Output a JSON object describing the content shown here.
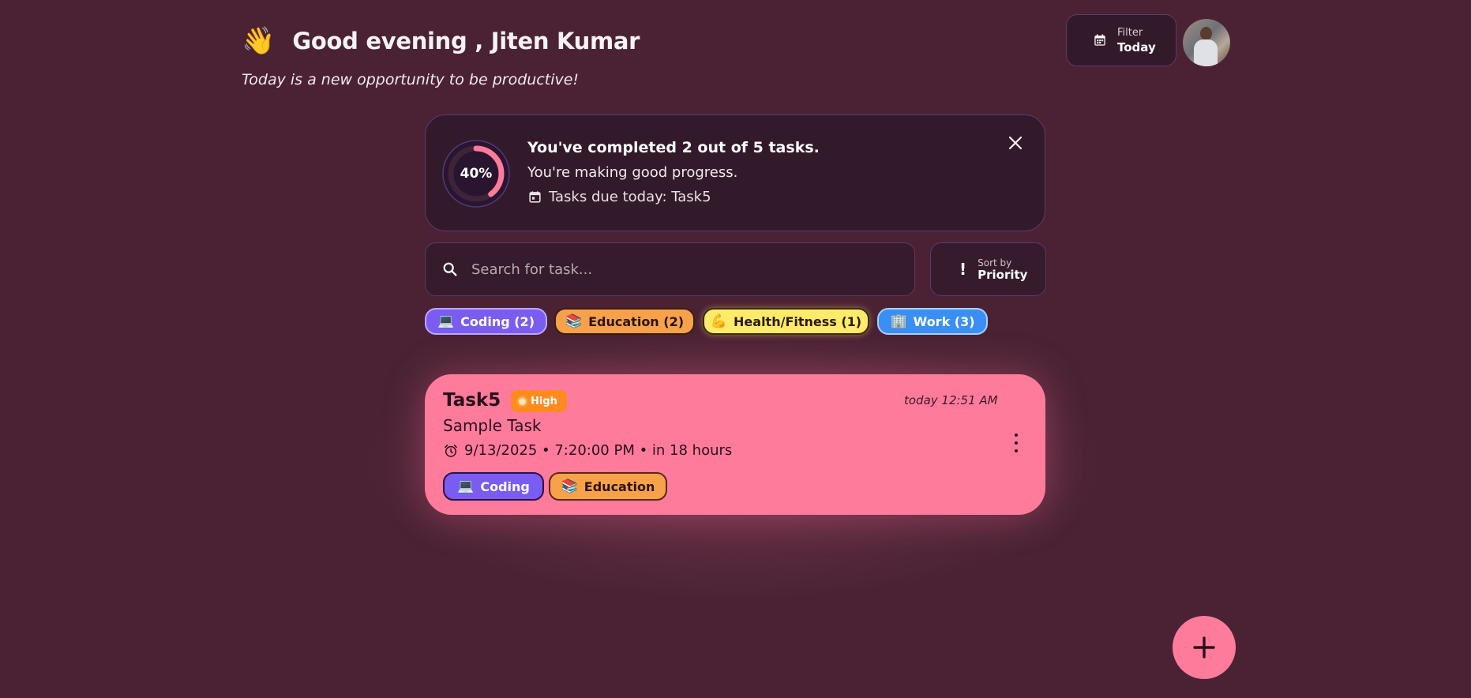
{
  "header": {
    "wave_emoji": "👋",
    "greeting": "Good evening , Jiten Kumar",
    "subtitle": "Today is a new opportunity to be productive!"
  },
  "filter": {
    "label": "Filter",
    "value": "Today",
    "icon": "calendar-icon"
  },
  "avatar": {
    "icon": "user-avatar"
  },
  "progress": {
    "percent_text": "40%",
    "fraction": 0.4,
    "title": "You've completed 2 out of 5 tasks.",
    "message": "You're making good progress.",
    "due_text": "Tasks due today: Task5",
    "ring_color": "#ff7b9c",
    "close_icon": "close-icon"
  },
  "search": {
    "placeholder": "Search for task...",
    "value": "",
    "icon": "search-icon"
  },
  "sort": {
    "label": "Sort by",
    "value": "Priority",
    "icon_glyph": "!"
  },
  "categories": [
    {
      "emoji": "💻",
      "label": "Coding (2)",
      "color": "#7b5cf0"
    },
    {
      "emoji": "📚",
      "label": "Education (2)",
      "color": "#f7a24a"
    },
    {
      "emoji": "💪",
      "label": "Health/Fitness (1)",
      "color": "#ffeb6a"
    },
    {
      "emoji": "🏢",
      "label": "Work (3)",
      "color": "#3a8ff5"
    }
  ],
  "task": {
    "name": "Task5",
    "priority": "High",
    "created": "today 12:51 AM",
    "description": "Sample Task",
    "due": "9/13/2025 • 7:20:00 PM • in 18 hours",
    "card_color": "#ff7b9c",
    "categories": [
      {
        "emoji": "💻",
        "label": "Coding"
      },
      {
        "emoji": "📚",
        "label": "Education"
      }
    ]
  },
  "fab": {
    "icon": "plus-icon"
  }
}
